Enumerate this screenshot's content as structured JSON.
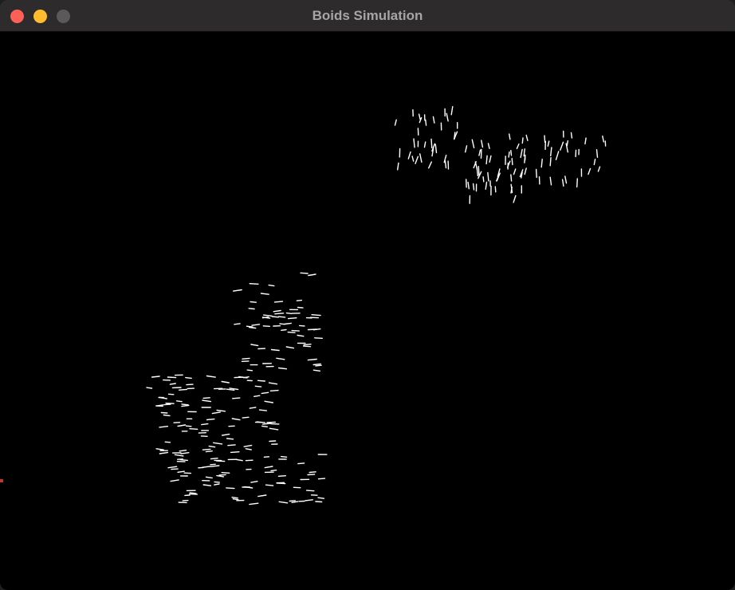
{
  "window": {
    "title": "Boids Simulation",
    "controls": {
      "close_color": "#fe5f57",
      "minimize_color": "#febc2e",
      "zoom_color": "#5a5a5a"
    }
  },
  "simulation": {
    "background_color": "#000000",
    "boid_color": "#ffffff",
    "flocks": [
      {
        "name": "upper-right-flock",
        "approx_count": 110,
        "heading": "vertical"
      },
      {
        "name": "lower-left-flock",
        "approx_count": 230,
        "heading": "horizontal"
      }
    ]
  }
}
